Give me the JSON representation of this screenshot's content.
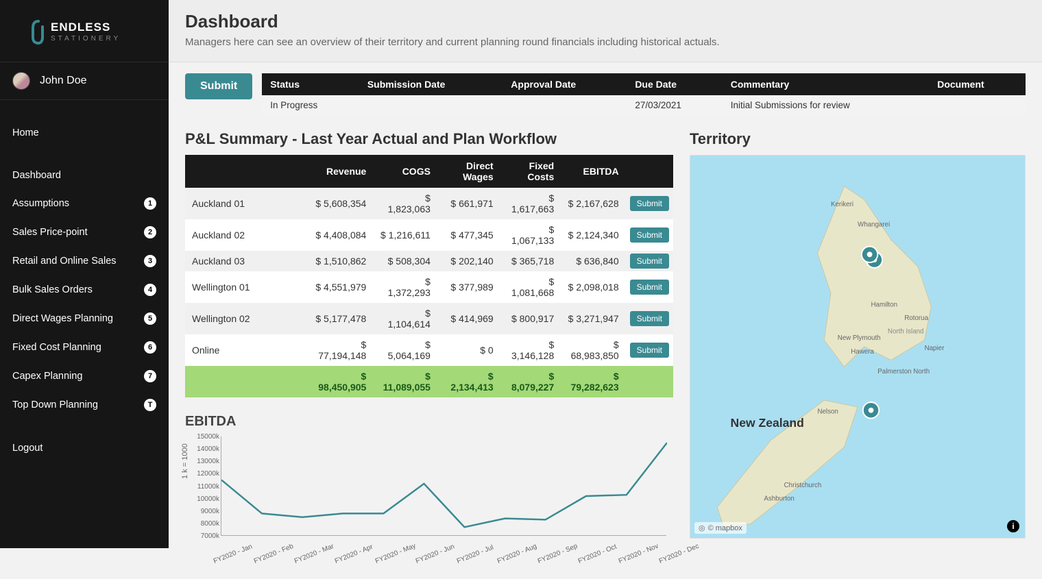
{
  "brand": {
    "name_top": "ENDLESS",
    "name_bottom": "STATIONERY"
  },
  "user": {
    "name": "John Doe"
  },
  "nav": {
    "home": "Home",
    "items": [
      {
        "label": "Dashboard",
        "badge": ""
      },
      {
        "label": "Assumptions",
        "badge": "1"
      },
      {
        "label": "Sales Price-point",
        "badge": "2"
      },
      {
        "label": "Retail and Online Sales",
        "badge": "3"
      },
      {
        "label": "Bulk Sales Orders",
        "badge": "4"
      },
      {
        "label": "Direct Wages Planning",
        "badge": "5"
      },
      {
        "label": "Fixed Cost Planning",
        "badge": "6"
      },
      {
        "label": "Capex Planning",
        "badge": "7"
      },
      {
        "label": "Top Down Planning",
        "badge": "T"
      }
    ],
    "logout": "Logout"
  },
  "header": {
    "title": "Dashboard",
    "subtitle": "Managers here can see an overview of their territory and current planning round financials including historical actuals."
  },
  "submit_label": "Submit",
  "status_table": {
    "headers": [
      "Status",
      "Submission Date",
      "Approval Date",
      "Due Date",
      "Commentary",
      "Document"
    ],
    "row": {
      "status": "In Progress",
      "submission_date": "",
      "approval_date": "",
      "due_date": "27/03/2021",
      "commentary": "Initial Submissions for review",
      "document": ""
    }
  },
  "pl": {
    "title": "P&L Summary - Last Year Actual and Plan Workflow",
    "headers": [
      "",
      "Revenue",
      "COGS",
      "Direct Wages",
      "Fixed Costs",
      "EBITDA",
      ""
    ],
    "submit_label": "Submit",
    "rows": [
      {
        "name": "Auckland 01",
        "revenue": "$ 5,608,354",
        "cogs": "$ 1,823,063",
        "wages": "$ 661,971",
        "fixed": "$ 1,617,663",
        "ebitda": "$ 2,167,628"
      },
      {
        "name": "Auckland 02",
        "revenue": "$ 4,408,084",
        "cogs": "$ 1,216,611",
        "wages": "$ 477,345",
        "fixed": "$ 1,067,133",
        "ebitda": "$ 2,124,340"
      },
      {
        "name": "Auckland 03",
        "revenue": "$ 1,510,862",
        "cogs": "$ 508,304",
        "wages": "$ 202,140",
        "fixed": "$ 365,718",
        "ebitda": "$ 636,840"
      },
      {
        "name": "Wellington 01",
        "revenue": "$ 4,551,979",
        "cogs": "$ 1,372,293",
        "wages": "$ 377,989",
        "fixed": "$ 1,081,668",
        "ebitda": "$ 2,098,018"
      },
      {
        "name": "Wellington 02",
        "revenue": "$ 5,177,478",
        "cogs": "$ 1,104,614",
        "wages": "$ 414,969",
        "fixed": "$ 800,917",
        "ebitda": "$ 3,271,947"
      },
      {
        "name": "Online",
        "revenue": "$ 77,194,148",
        "cogs": "$ 5,064,169",
        "wages": "$ 0",
        "fixed": "$ 3,146,128",
        "ebitda": "$ 68,983,850"
      }
    ],
    "total": {
      "revenue": "$ 98,450,905",
      "cogs": "$ 11,089,055",
      "wages": "$ 2,134,413",
      "fixed": "$ 8,079,227",
      "ebitda": "$ 79,282,623"
    }
  },
  "territory_title": "Territory",
  "map": {
    "label_nz": "New Zealand",
    "places": [
      "Kerikeri",
      "Whangarei",
      "Hamilton",
      "Rotorua",
      "North Island",
      "New Plymouth",
      "Hawera",
      "Napier",
      "Palmerston North",
      "Nelson",
      "Christchurch",
      "Ashburton"
    ],
    "attribution": "© mapbox"
  },
  "chart_data": {
    "type": "line",
    "title": "EBITDA",
    "ylabel": "1 k = 1000",
    "ylim": [
      7000,
      15000
    ],
    "yticks": [
      7000,
      8000,
      9000,
      10000,
      11000,
      12000,
      13000,
      14000,
      15000
    ],
    "ytick_labels": [
      "7000k",
      "8000k",
      "9000k",
      "10000k",
      "11000k",
      "12000k",
      "13000k",
      "14000k",
      "15000k"
    ],
    "categories": [
      "FY2020 - Jan",
      "FY2020 - Feb",
      "FY2020 - Mar",
      "FY2020 - Apr",
      "FY2020 - May",
      "FY2020 - Jun",
      "FY2020 - Jul",
      "FY2020 - Aug",
      "FY2020 - Sep",
      "FY2020 - Oct",
      "FY2020 - Nov",
      "FY2020 - Dec"
    ],
    "values": [
      11500,
      8800,
      8500,
      8800,
      8800,
      11200,
      7700,
      8400,
      8300,
      10200,
      10300,
      14500
    ]
  }
}
